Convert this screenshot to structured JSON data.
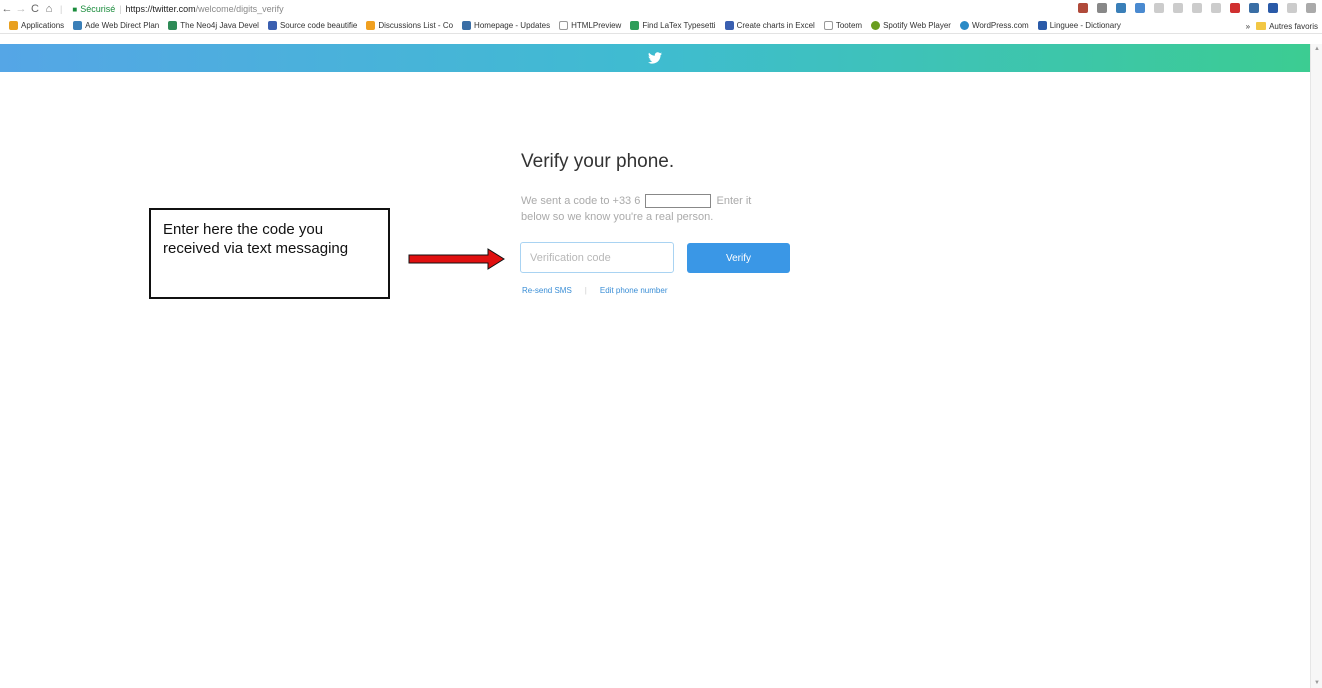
{
  "browser": {
    "secure_label": "Sécurisé",
    "url_host": "https://twitter.com",
    "url_path": "/welcome/digits_verify",
    "bookmarks": [
      {
        "label": "Applications",
        "color": "#4a7bd0"
      },
      {
        "label": "Ade Web Direct Plan",
        "color": "#3a7fb8"
      },
      {
        "label": "The Neo4j Java Devel",
        "color": "#2e8b57"
      },
      {
        "label": "Source code beautifie",
        "color": "#3a5fb0"
      },
      {
        "label": "Discussions List - Co",
        "color": "#f0a020"
      },
      {
        "label": "Homepage - Updates",
        "color": "#3a6ea5"
      },
      {
        "label": "HTMLPreview",
        "color": "#999999"
      },
      {
        "label": "Find LaTex Typesetti",
        "color": "#2e9e5a"
      },
      {
        "label": "Create charts in Excel",
        "color": "#3a5fb0"
      },
      {
        "label": "Tootem",
        "color": "#999999"
      },
      {
        "label": "Spotify Web Player",
        "color": "#6a9e20"
      },
      {
        "label": "WordPress.com",
        "color": "#2a8ac6"
      },
      {
        "label": "Linguee - Dictionary",
        "color": "#2a5aa8"
      }
    ],
    "more_label": "»",
    "other_bookmarks": "Autres favoris"
  },
  "page": {
    "title": "Verify your phone.",
    "desc_before": "We sent a code to +33 6",
    "desc_after": "Enter it below so we know you're a real person.",
    "input_placeholder": "Verification code",
    "verify_label": "Verify",
    "resend_label": "Re-send SMS",
    "link_separator": "|",
    "edit_label": "Edit phone number"
  },
  "annotation": {
    "text": "Enter here the code you received via text messaging"
  },
  "colors": {
    "header_start": "#55a6e6",
    "header_end": "#3ccc92",
    "verify_button": "#3a97e6",
    "arrow": "#e01010"
  }
}
